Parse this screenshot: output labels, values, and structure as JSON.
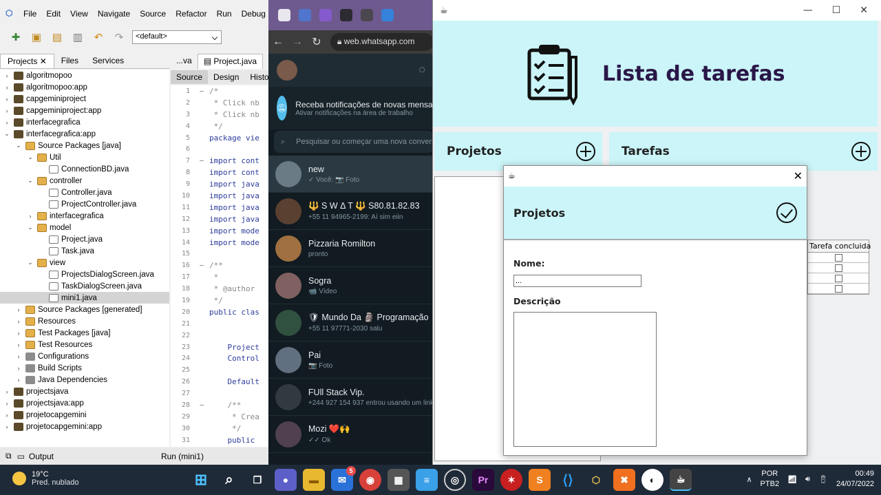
{
  "netbeans": {
    "menu": [
      "File",
      "Edit",
      "View",
      "Navigate",
      "Source",
      "Refactor",
      "Run",
      "Debug"
    ],
    "config": "<default>",
    "panel_tabs": [
      "Projects",
      "Files",
      "Services"
    ],
    "tree": [
      {
        "label": "algoritmopoo",
        "depth": 0,
        "kind": "proj",
        "open": false
      },
      {
        "label": "algoritmopoo:app",
        "depth": 0,
        "kind": "proj",
        "open": false
      },
      {
        "label": "capgeminiproject",
        "depth": 0,
        "kind": "proj",
        "open": false
      },
      {
        "label": "capgeminiproject:app",
        "depth": 0,
        "kind": "proj",
        "open": false
      },
      {
        "label": "interfacegrafica",
        "depth": 0,
        "kind": "proj",
        "open": false
      },
      {
        "label": "interfacegrafica:app",
        "depth": 0,
        "kind": "proj",
        "open": true
      },
      {
        "label": "Source Packages [java]",
        "depth": 1,
        "kind": "pkg",
        "open": true
      },
      {
        "label": "Util",
        "depth": 2,
        "kind": "pkg",
        "open": true
      },
      {
        "label": "ConnectionBD.java",
        "depth": 3,
        "kind": "file",
        "open": null
      },
      {
        "label": "controller",
        "depth": 2,
        "kind": "pkg",
        "open": true
      },
      {
        "label": "Controller.java",
        "depth": 3,
        "kind": "file",
        "open": null
      },
      {
        "label": "ProjectController.java",
        "depth": 3,
        "kind": "file",
        "open": null
      },
      {
        "label": "interfacegrafica",
        "depth": 2,
        "kind": "pkg",
        "open": false
      },
      {
        "label": "model",
        "depth": 2,
        "kind": "pkg",
        "open": true
      },
      {
        "label": "Project.java",
        "depth": 3,
        "kind": "file",
        "open": null
      },
      {
        "label": "Task.java",
        "depth": 3,
        "kind": "file",
        "open": null
      },
      {
        "label": "view",
        "depth": 2,
        "kind": "pkg",
        "open": true
      },
      {
        "label": "ProjectsDialogScreen.java",
        "depth": 3,
        "kind": "file",
        "open": null
      },
      {
        "label": "TaskDialogScreen.java",
        "depth": 3,
        "kind": "file",
        "open": null
      },
      {
        "label": "mini1.java",
        "depth": 3,
        "kind": "file",
        "open": null,
        "selected": true
      },
      {
        "label": "Source Packages [generated]",
        "depth": 1,
        "kind": "pkg",
        "open": false
      },
      {
        "label": "Resources",
        "depth": 1,
        "kind": "pkg",
        "open": false
      },
      {
        "label": "Test Packages [java]",
        "depth": 1,
        "kind": "pkg",
        "open": false
      },
      {
        "label": "Test Resources",
        "depth": 1,
        "kind": "pkg",
        "open": false
      },
      {
        "label": "Configurations",
        "depth": 1,
        "kind": "lib",
        "open": false
      },
      {
        "label": "Build Scripts",
        "depth": 1,
        "kind": "lib",
        "open": false
      },
      {
        "label": "Java Dependencies",
        "depth": 1,
        "kind": "lib",
        "open": false
      },
      {
        "label": "projectsjava",
        "depth": 0,
        "kind": "proj",
        "open": false
      },
      {
        "label": "projectsjava:app",
        "depth": 0,
        "kind": "proj",
        "open": false
      },
      {
        "label": "projetocapgemini",
        "depth": 0,
        "kind": "proj",
        "open": false
      },
      {
        "label": "projetocapgemini:app",
        "depth": 0,
        "kind": "proj",
        "open": false
      }
    ],
    "editor_tabs": [
      "...va",
      "Project.java"
    ],
    "source_tabs": [
      "Source",
      "Design",
      "Histo"
    ],
    "code": [
      {
        "n": "1",
        "fold": "−",
        "t": "/*",
        "c": true
      },
      {
        "n": "2",
        "fold": "",
        "t": " * Click nb",
        "c": true
      },
      {
        "n": "3",
        "fold": "",
        "t": " * Click nb",
        "c": true
      },
      {
        "n": "4",
        "fold": "",
        "t": " */",
        "c": true
      },
      {
        "n": "5",
        "fold": "",
        "t": "package vie",
        "c": false
      },
      {
        "n": "6",
        "fold": "",
        "t": "",
        "c": false
      },
      {
        "n": "7",
        "fold": "−",
        "t": "import cont",
        "c": false
      },
      {
        "n": "8",
        "fold": "",
        "t": "import cont",
        "c": false
      },
      {
        "n": "9",
        "fold": "",
        "t": "import java",
        "c": false
      },
      {
        "n": "10",
        "fold": "",
        "t": "import java",
        "c": false
      },
      {
        "n": "11",
        "fold": "",
        "t": "import java",
        "c": false
      },
      {
        "n": "12",
        "fold": "",
        "t": "import java",
        "c": false
      },
      {
        "n": "13",
        "fold": "",
        "t": "import mode",
        "c": false
      },
      {
        "n": "14",
        "fold": "",
        "t": "import mode",
        "c": false
      },
      {
        "n": "15",
        "fold": "",
        "t": "",
        "c": false
      },
      {
        "n": "16",
        "fold": "−",
        "t": "/**",
        "c": true
      },
      {
        "n": "17",
        "fold": "",
        "t": " *",
        "c": true
      },
      {
        "n": "18",
        "fold": "",
        "t": " * @author",
        "c": true
      },
      {
        "n": "19",
        "fold": "",
        "t": " */",
        "c": true
      },
      {
        "n": "20",
        "fold": "",
        "t": "public clas",
        "c": false
      },
      {
        "n": "21",
        "fold": "",
        "t": "",
        "c": false
      },
      {
        "n": "22",
        "fold": "",
        "t": "",
        "c": false
      },
      {
        "n": "23",
        "fold": "",
        "t": "    Project",
        "c": false
      },
      {
        "n": "24",
        "fold": "",
        "t": "    Control",
        "c": false
      },
      {
        "n": "25",
        "fold": "",
        "t": "",
        "c": false
      },
      {
        "n": "26",
        "fold": "",
        "t": "    Default",
        "c": false
      },
      {
        "n": "27",
        "fold": "",
        "t": "",
        "c": false
      },
      {
        "n": "28",
        "fold": "−",
        "t": "    /**",
        "c": true
      },
      {
        "n": "29",
        "fold": "",
        "t": "     * Crea",
        "c": true
      },
      {
        "n": "30",
        "fold": "",
        "t": "     */",
        "c": true
      },
      {
        "n": "31",
        "fold": "",
        "t": "    public",
        "c": false
      }
    ],
    "output_label": "Output",
    "run_label": "Run (mini1)"
  },
  "browser": {
    "url": "web.whatsapp.com",
    "notif_title": "Receba notificações de novas mensagens",
    "notif_sub": "Ativar notificações na área de trabalho",
    "search_placeholder": "Pesquisar ou começar uma nova conversa",
    "chats": [
      {
        "name": "new",
        "msg": "✓ Você: 📷 Foto",
        "color": "#6b7b85"
      },
      {
        "name": "🔱 S W Δ T 🔱 S80.81.82.83",
        "msg": "+55 11 94965-2199: Aí sim eiin",
        "color": "#5a4030"
      },
      {
        "name": "Pizzaria Romilton",
        "msg": "pronto",
        "color": "#a07040"
      },
      {
        "name": "Sogra",
        "msg": "📹 Vídeo",
        "color": "#806060"
      },
      {
        "name": "🛡 Mundo Da 🗿 Programação",
        "msg": "+55 11 97771-2030 salu",
        "color": "#305040"
      },
      {
        "name": "Pai",
        "msg": "📷 Foto",
        "color": "#607080"
      },
      {
        "name": "FUll Stack Vip.",
        "msg": "+244 927 154 937 entrou usando um link",
        "color": "#303a40"
      },
      {
        "name": "Mozi ❤️🙌",
        "msg": "✓✓ Ok",
        "color": "#504050"
      }
    ]
  },
  "app": {
    "title": "Lista de tarefas",
    "projects_label": "Projetos",
    "tasks_label": "Tarefas",
    "table_header": "Tarefa concluida",
    "table_rows": 4
  },
  "dialog": {
    "header": "Projetos",
    "name_label": "Nome:",
    "name_value": "...",
    "desc_label": "Descrição"
  },
  "taskbar": {
    "temp": "19°C",
    "weather": "Pred. nublado",
    "lang": "POR",
    "layout": "PTB2",
    "time": "00:49",
    "date": "24/07/2022",
    "badge": "5"
  }
}
